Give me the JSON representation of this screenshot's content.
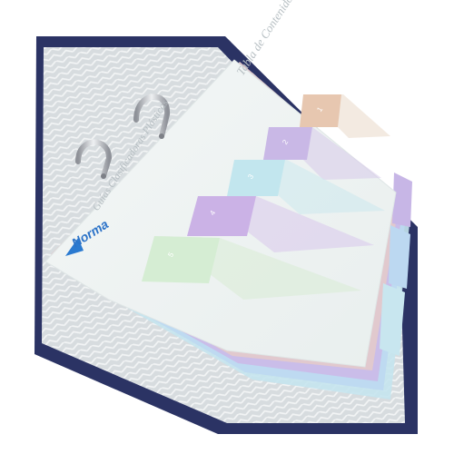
{
  "photo": {
    "subject": "Binder with colored plastic index dividers",
    "binder_color": "#2d3566",
    "liner_color": "#d8dde0",
    "paper_color": "#eef3f3",
    "ring_color": "#b9bcc3"
  },
  "index_sheet": {
    "title": "Tabla de Contenido",
    "subtitle": "Guías Clasificadoras Plásticas",
    "brand": "Norma",
    "tab_numbers": [
      "1",
      "2",
      "3",
      "4",
      "5"
    ],
    "tab_colors": [
      "#e7c7b0",
      "#c9b8e6",
      "#c2e6ee",
      "#cbb2e6",
      "#d5edd3"
    ]
  },
  "dividers": {
    "colors": [
      "#e4c9c9",
      "#cbb8e8",
      "#bcd9f0",
      "#c8e7ef"
    ]
  }
}
